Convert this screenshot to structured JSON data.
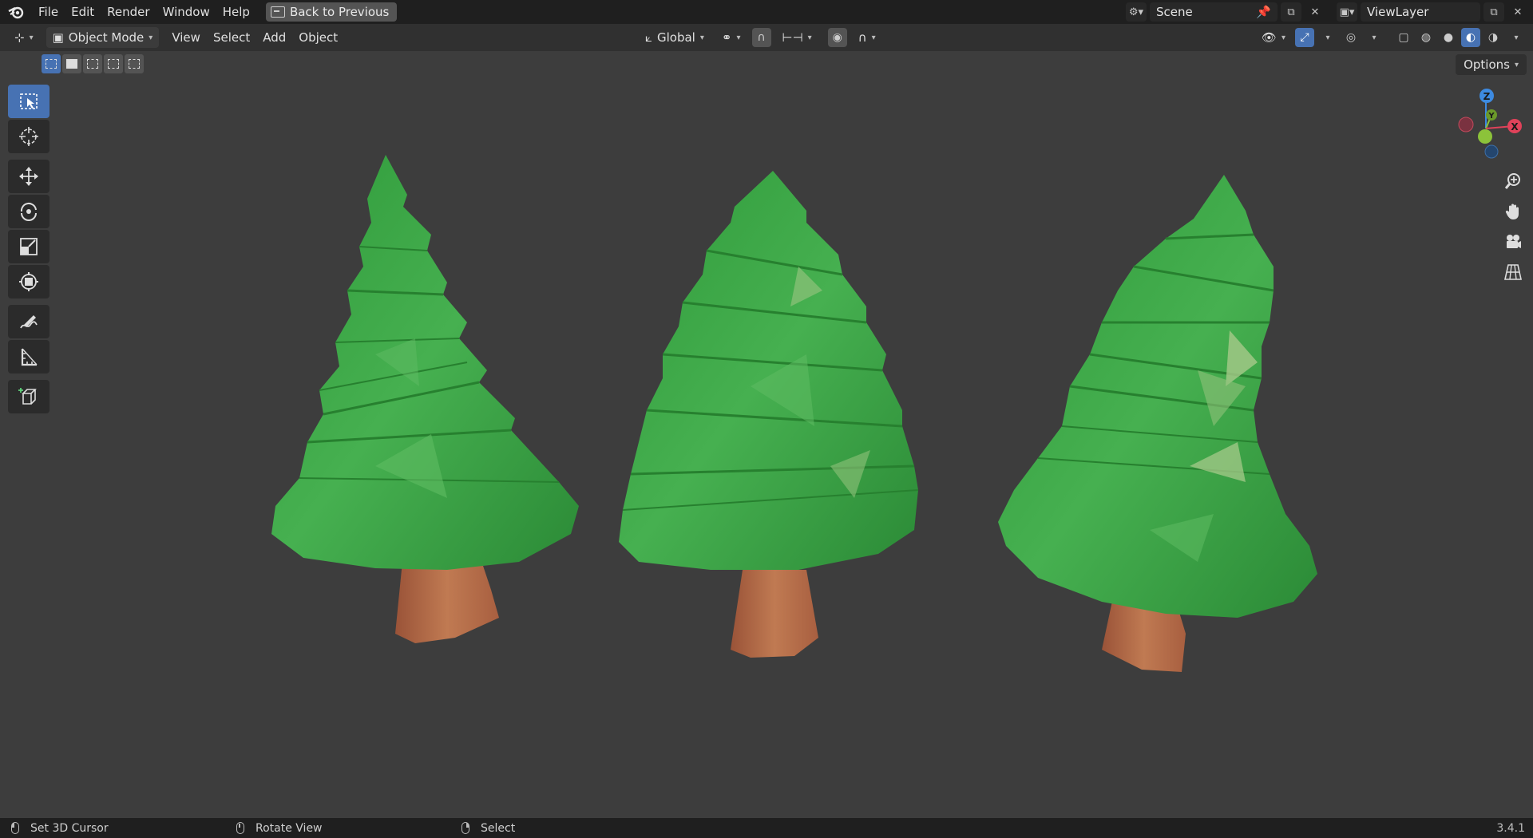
{
  "topbar": {
    "menu": [
      "File",
      "Edit",
      "Render",
      "Window",
      "Help"
    ],
    "back_label": "Back to Previous",
    "scene_name": "Scene",
    "view_layer": "ViewLayer"
  },
  "header": {
    "mode": "Object Mode",
    "menus": [
      "View",
      "Select",
      "Add",
      "Object"
    ],
    "orientation": "Global"
  },
  "options_label": "Options",
  "gizmo": {
    "z": "Z",
    "y": "Y",
    "x": "X"
  },
  "status": {
    "left_click": "Set 3D Cursor",
    "middle_click": "Rotate View",
    "right_click": "Select",
    "version": "3.4.1"
  },
  "colors": {
    "accent": "#4772b3",
    "foliage": "#3aa143",
    "trunk": "#b06a45",
    "axis_x": "#e0425a",
    "axis_y": "#8cc33a",
    "axis_z": "#3d8ae0"
  }
}
